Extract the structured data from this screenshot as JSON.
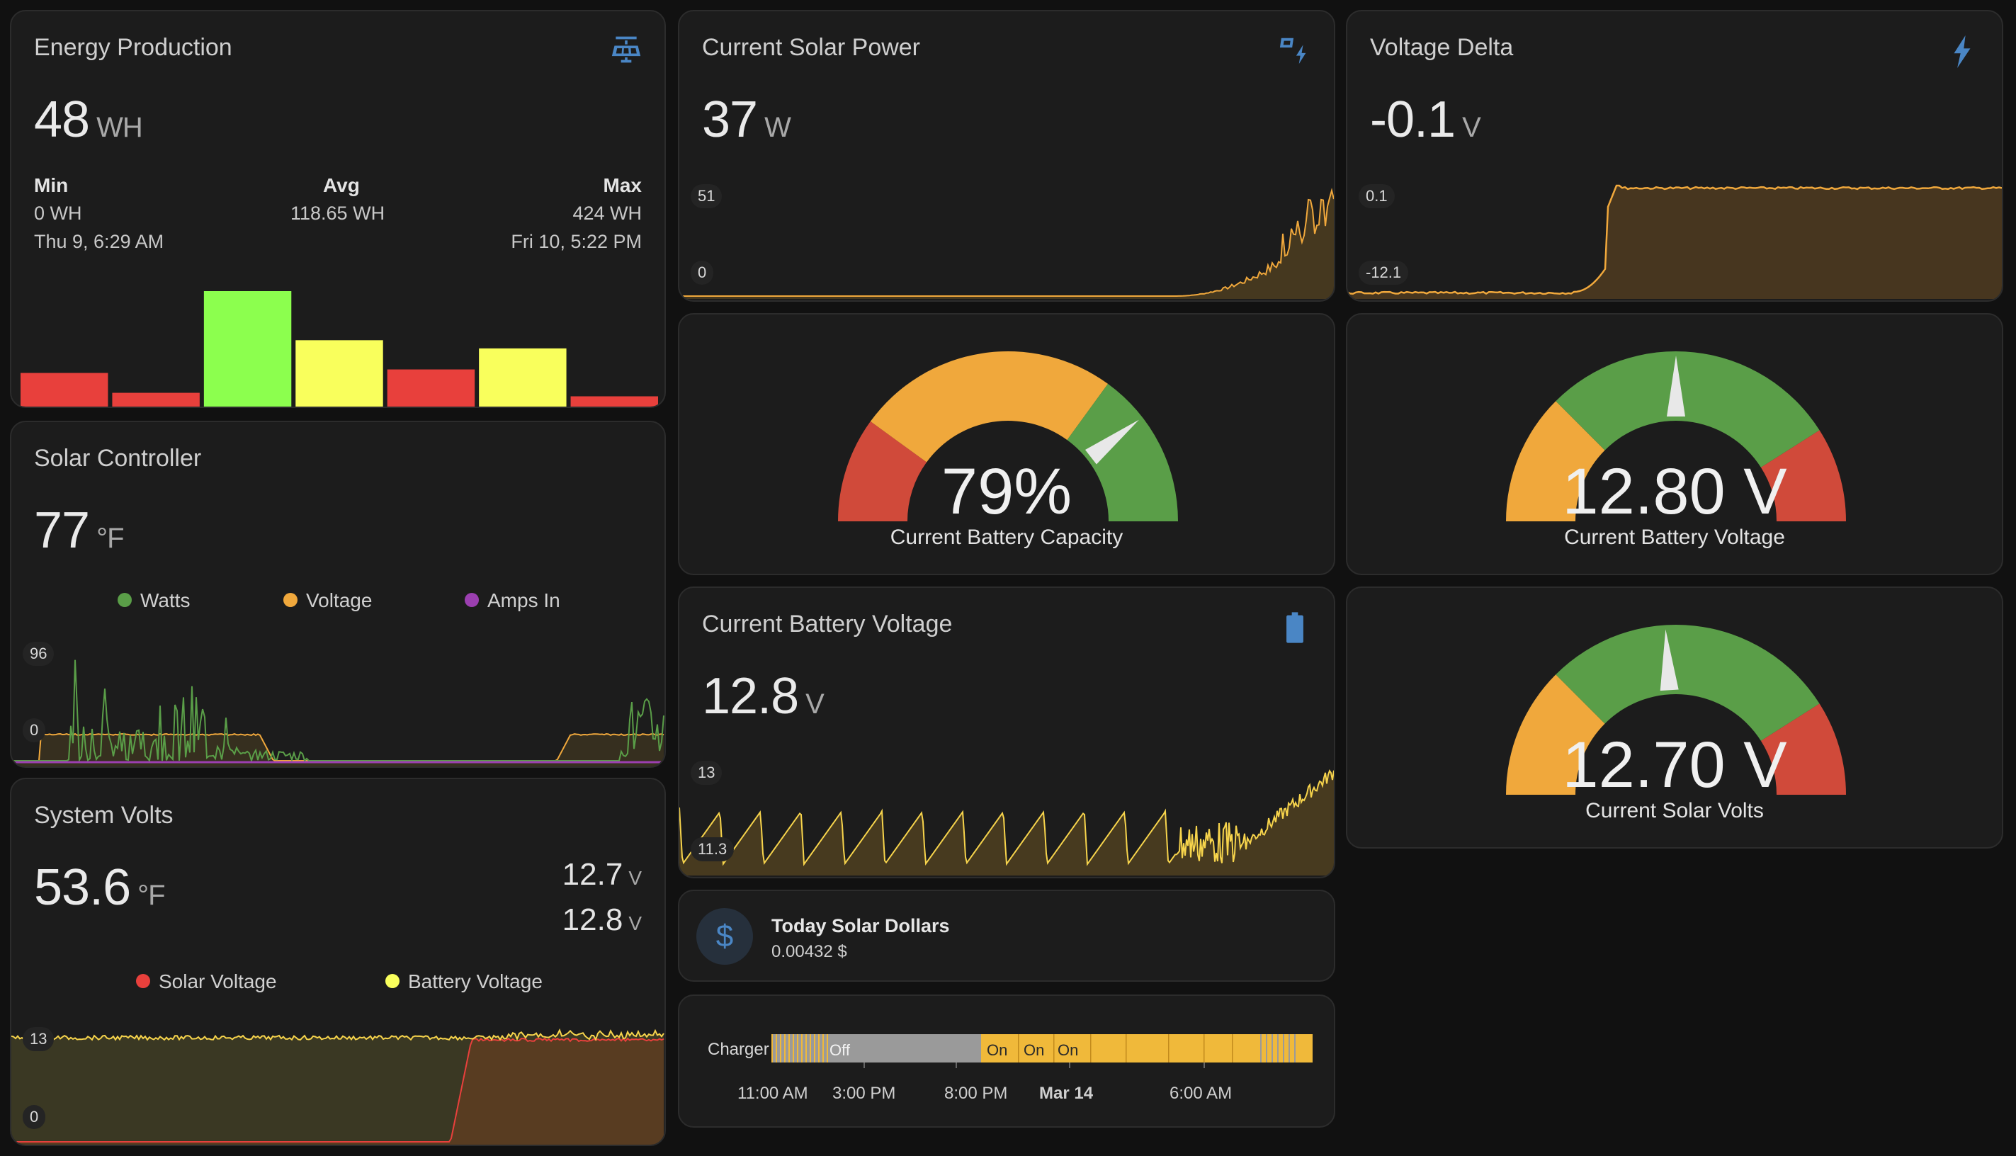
{
  "colors": {
    "background": "#111111",
    "card": "#1c1c1c",
    "green": "#5a9e48",
    "orange": "#f0a83c",
    "red": "#d04a3a",
    "yellow": "#f7d44c",
    "bar_green": "#8cff4e",
    "bar_yellow": "#f9ff5c",
    "bar_red": "#e8403c",
    "purple": "#9b3fb0",
    "icon_blue": "#4a86c5"
  },
  "energy_production": {
    "title": "Energy Production",
    "icon": "solar-panel-icon",
    "value": "48",
    "unit": "WH",
    "min_label": "Min",
    "min_value": "0 WH",
    "min_time": "Thu 9, 6:29 AM",
    "avg_label": "Avg",
    "avg_value": "118.65 WH",
    "max_label": "Max",
    "max_value": "424 WH",
    "max_time": "Fri 10, 5:22 PM",
    "bars": [
      {
        "value": 0.3,
        "color": "red"
      },
      {
        "value": 0.13,
        "color": "red"
      },
      {
        "value": 1.0,
        "color": "green"
      },
      {
        "value": 0.58,
        "color": "yellow"
      },
      {
        "value": 0.33,
        "color": "red"
      },
      {
        "value": 0.51,
        "color": "yellow"
      },
      {
        "value": 0.1,
        "color": "red"
      }
    ]
  },
  "current_solar_power": {
    "title": "Current Solar Power",
    "icon": "solar-power-icon",
    "value": "37",
    "unit": "W",
    "axis_max": "51",
    "axis_min": "0"
  },
  "voltage_delta": {
    "title": "Voltage Delta",
    "icon": "flash-icon",
    "value": "-0.1",
    "unit": "V",
    "axis_max": "0.1",
    "axis_min": "-12.1"
  },
  "battery_capacity_gauge": {
    "value": "79%",
    "level": 0.79,
    "label": "Current Battery Capacity"
  },
  "battery_voltage_gauge": {
    "value": "12.80 V",
    "level": 0.5,
    "label": "Current Battery Voltage"
  },
  "solar_volts_gauge": {
    "value": "12.70 V",
    "level": 0.48,
    "label": "Current Solar Volts"
  },
  "solar_controller": {
    "title": "Solar Controller",
    "value": "77",
    "unit": "°F",
    "legend": [
      "Watts",
      "Voltage",
      "Amps In"
    ],
    "axis_max": "96",
    "axis_min": "0"
  },
  "current_battery_voltage": {
    "title": "Current Battery Voltage",
    "icon": "battery-icon",
    "value": "12.8",
    "unit": "V",
    "axis_max": "13",
    "axis_min": "11.3"
  },
  "system_volts": {
    "title": "System Volts",
    "value": "53.6",
    "unit": "°F",
    "secondary_1": "12.7",
    "secondary_1_unit": "V",
    "secondary_2": "12.8",
    "secondary_2_unit": "V",
    "legend": [
      "Solar Voltage",
      "Battery Voltage"
    ],
    "axis_max": "13",
    "axis_min": "0"
  },
  "solar_dollars": {
    "icon": "dollar-icon",
    "title": "Today Solar Dollars",
    "value": "0.00432 $"
  },
  "charger_timeline": {
    "label": "Charger",
    "states": [
      "Off",
      "On",
      "On",
      "On"
    ],
    "ticks": [
      "11:00 AM",
      "3:00 PM",
      "8:00 PM",
      "Mar 14",
      "6:00 AM"
    ]
  }
}
